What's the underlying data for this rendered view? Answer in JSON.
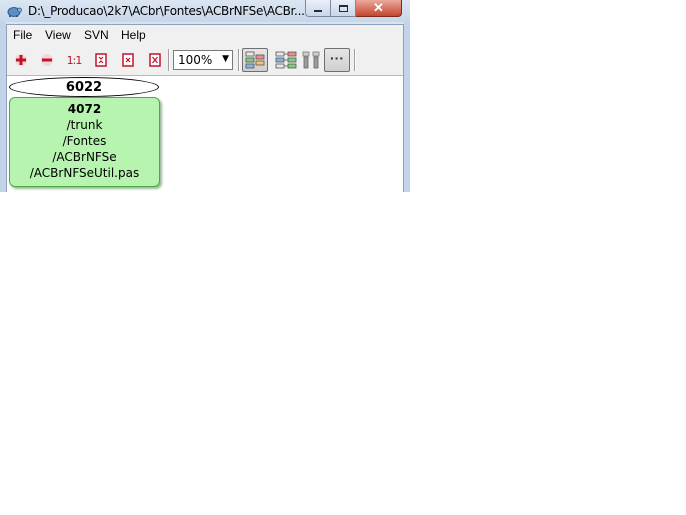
{
  "window": {
    "title": "D:\\_Producao\\2k7\\ACbr\\Fontes\\ACBrNFSe\\ACBr...",
    "minimize_icon": "minimize-icon",
    "maximize_icon": "maximize-icon",
    "close_icon": "close-icon"
  },
  "menu": {
    "file": "File",
    "view": "View",
    "svn": "SVN",
    "help": "Help"
  },
  "toolbar": {
    "zoom_in_icon": "zoom-in-icon",
    "zoom_out_icon": "zoom-out-icon",
    "zoom_100_label": "1:1",
    "fit_width_icon": "fit-width-icon",
    "fit_height_icon": "fit-height-icon",
    "fit_all_icon": "fit-all-icon",
    "zoom_value": "100%",
    "zoom_options": [
      "100%"
    ]
  },
  "graph": {
    "top_node_rev": "6022",
    "node": {
      "rev": "4072",
      "path_lines": [
        "/trunk",
        "/Fontes",
        "/ACBrNFSe",
        "/ACBrNFSeUtil.pas"
      ]
    }
  },
  "colors": {
    "node_fill": "#b6f4b0",
    "node_border": "#4caa45",
    "toolbar_red": "#c0142b",
    "title_bar": "#c7d6ea"
  }
}
